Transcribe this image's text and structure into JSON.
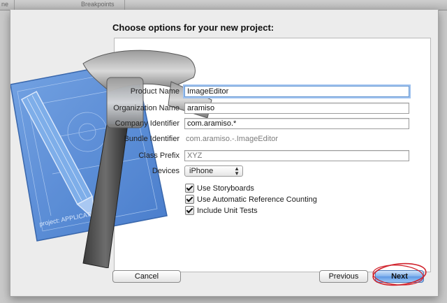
{
  "background_window": {
    "toolbar_left_text": "ne",
    "toolbar_breakpoints_label": "Breakpoints"
  },
  "sheet": {
    "heading": "Choose options for your new project:",
    "fields": {
      "product_name": {
        "label": "Product Name",
        "value": "ImageEditor"
      },
      "organization_name": {
        "label": "Organization Name",
        "value": "aramiso"
      },
      "company_identifier": {
        "label": "Company Identifier",
        "value": "com.aramiso.*"
      },
      "bundle_identifier": {
        "label": "Bundle Identifier",
        "value": "com.aramiso.-.ImageEditor"
      },
      "class_prefix": {
        "label": "Class Prefix",
        "placeholder": "XYZ"
      },
      "devices": {
        "label": "Devices",
        "selected": "iPhone"
      }
    },
    "checkboxes": [
      {
        "label": "Use Storyboards",
        "checked": true
      },
      {
        "label": "Use Automatic Reference Counting",
        "checked": true
      },
      {
        "label": "Include Unit Tests",
        "checked": true
      }
    ],
    "blueprint_text": "project: APPLICATION APP",
    "buttons": {
      "cancel": "Cancel",
      "previous": "Previous",
      "next": "Next"
    }
  },
  "colors": {
    "focus_ring": "#9ec1ef",
    "default_button": "#5d98e4",
    "annotation_circle": "#d0202a",
    "blueprint": "#4f86d6"
  }
}
